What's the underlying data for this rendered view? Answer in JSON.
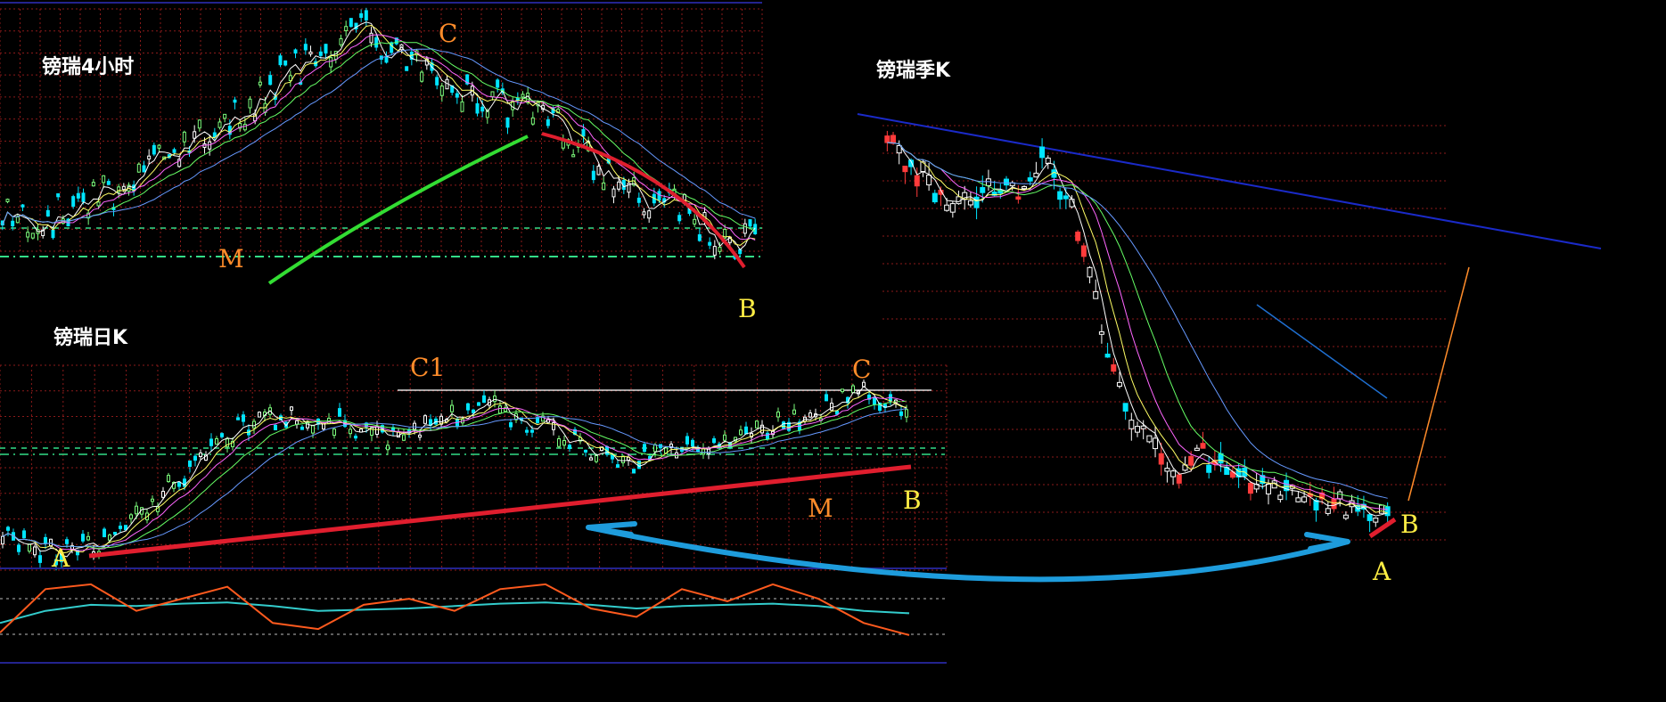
{
  "colors": {
    "background": "#000000",
    "grid": "#8b1a1a",
    "grid_blue": "#23238e",
    "candle_up": "#ffffff",
    "candle_up_alt": "#7cfc7c",
    "candle_down": "#00e5ff",
    "candle_red": "#ff3b3b",
    "ma1": "#ffffff",
    "ma2": "#ffff66",
    "ma3": "#ff66ff",
    "ma4": "#66ff66",
    "ma5": "#6699ff",
    "annotation_orange": "#ff8c2a",
    "annotation_yellow": "#ffee44",
    "trend_green": "#33dd33",
    "trend_red": "#e01e2e",
    "trend_navy": "#1a2ac8",
    "arrow_blue": "#1e9cdc",
    "osc_orange": "#ff5a1e",
    "osc_cyan": "#33cccc"
  },
  "chart_data": [
    {
      "type": "candlestick",
      "title": "镑瑞4小时",
      "annotations": [
        "C",
        "M",
        "B"
      ],
      "trend": [
        8,
        7,
        9,
        12,
        15,
        20,
        22,
        28,
        30,
        35,
        32,
        27,
        25,
        23,
        21,
        15,
        11,
        9,
        5,
        4
      ]
    },
    {
      "type": "candlestick",
      "title": "镑瑞日K",
      "annotations": [
        "C1",
        "C",
        "B",
        "M",
        "A"
      ],
      "trend": [
        6,
        3,
        4,
        10,
        18,
        24,
        26,
        25,
        22,
        24,
        28,
        25,
        22,
        18,
        20,
        22,
        24,
        26,
        30,
        26
      ],
      "oscillator": {
        "fast": [
          22,
          58,
          62,
          40,
          50,
          60,
          30,
          25,
          45,
          50,
          40,
          58,
          62,
          42,
          35,
          58,
          48,
          62,
          50,
          30,
          20
        ],
        "slow": [
          30,
          40,
          45,
          44,
          46,
          47,
          44,
          40,
          41,
          42,
          44,
          46,
          47,
          45,
          42,
          44,
          45,
          46,
          44,
          40,
          38
        ]
      }
    },
    {
      "type": "candlestick",
      "title": "镑瑞季K",
      "annotations": [
        "B",
        "A"
      ],
      "trend": [
        70,
        64,
        60,
        58,
        61,
        60,
        66,
        58,
        40,
        25,
        18,
        14,
        16,
        15,
        12,
        10,
        9,
        8,
        7,
        6
      ]
    }
  ]
}
